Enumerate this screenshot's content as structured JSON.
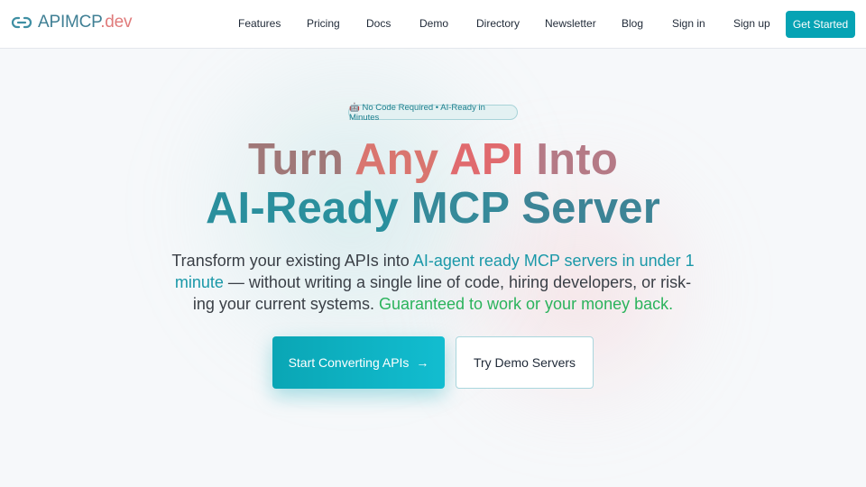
{
  "header": {
    "logo": {
      "main": "APIMCP",
      "tld": ".dev",
      "icon": "link-icon"
    },
    "nav": [
      {
        "label": "Features"
      },
      {
        "label": "Pricing"
      },
      {
        "label": "Docs"
      },
      {
        "label": "Demo"
      },
      {
        "label": "Directory"
      },
      {
        "label": "Newsletter"
      },
      {
        "label": "Blog"
      },
      {
        "label": "Sign in"
      },
      {
        "label": "Sign up"
      }
    ],
    "cta": "Get Started"
  },
  "hero": {
    "badge": "🤖 No Code Required • AI-Ready in Minutes",
    "title_line1": {
      "turn": "Turn",
      "any": "Any",
      "api": "API",
      "into": "Into"
    },
    "title_line2": {
      "ai_ready": "AI-Ready",
      "mcp": "MCP",
      "server": "Server"
    },
    "subtitle": {
      "line1_plain": "Transform your existing APIs into ",
      "line1_highlight": "AI-agent ready MCP servers in under 1",
      "line2_highlight": "minute",
      "line2_plain": " — without writing a single line of code, hiring developers, or risk-",
      "line3_plain": "ing your current systems. ",
      "line3_guarantee": "Guaranteed to work or your money back."
    },
    "primary_button": "Start Converting APIs",
    "primary_button_icon": "arrow-right-icon",
    "arrow_glyph": "→",
    "secondary_button": "Try Demo Servers"
  },
  "colors": {
    "brand_teal": "#06a3b4",
    "logo_tld": "#e07b7b",
    "highlight_teal": "#1a98a8",
    "guarantee_green": "#2bb35c"
  }
}
